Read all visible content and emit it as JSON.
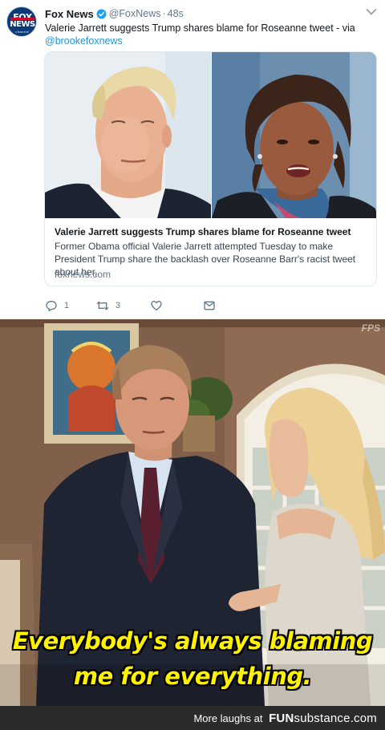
{
  "tweet": {
    "avatar_name": "fox-news-logo",
    "display_name": "Fox News",
    "handle": "@FoxNews",
    "separator": "·",
    "time": "48s",
    "text": "Valerie Jarrett suggests Trump shares blame for Roseanne tweet - via",
    "mention": "@brookefoxnews",
    "card": {
      "title": "Valerie Jarrett suggests Trump shares blame for Roseanne tweet",
      "description": "Former Obama official Valerie Jarrett attempted Tuesday to make President Trump share the backlash over Roseanne Barr's racist tweet about her,",
      "domain": "foxnews.com"
    },
    "actions": {
      "reply_count": "1",
      "retweet_count": "3",
      "like_count": "",
      "icons": [
        "reply-icon",
        "retweet-icon",
        "like-icon",
        "message-icon"
      ]
    }
  },
  "meme": {
    "watermark": "FPS",
    "caption_line1": "Everybody's always blaming",
    "caption_line2": "me for everything."
  },
  "footer": {
    "prefix": "More laughs at",
    "brand_main": "FUN",
    "brand_sub": "substance",
    "brand_tld": ".com"
  },
  "colors": {
    "link": "#1b95e0",
    "muted": "#657786",
    "verified": "#1da1f2",
    "caption": "#fff200",
    "footer_bg": "#2b2b2b"
  }
}
